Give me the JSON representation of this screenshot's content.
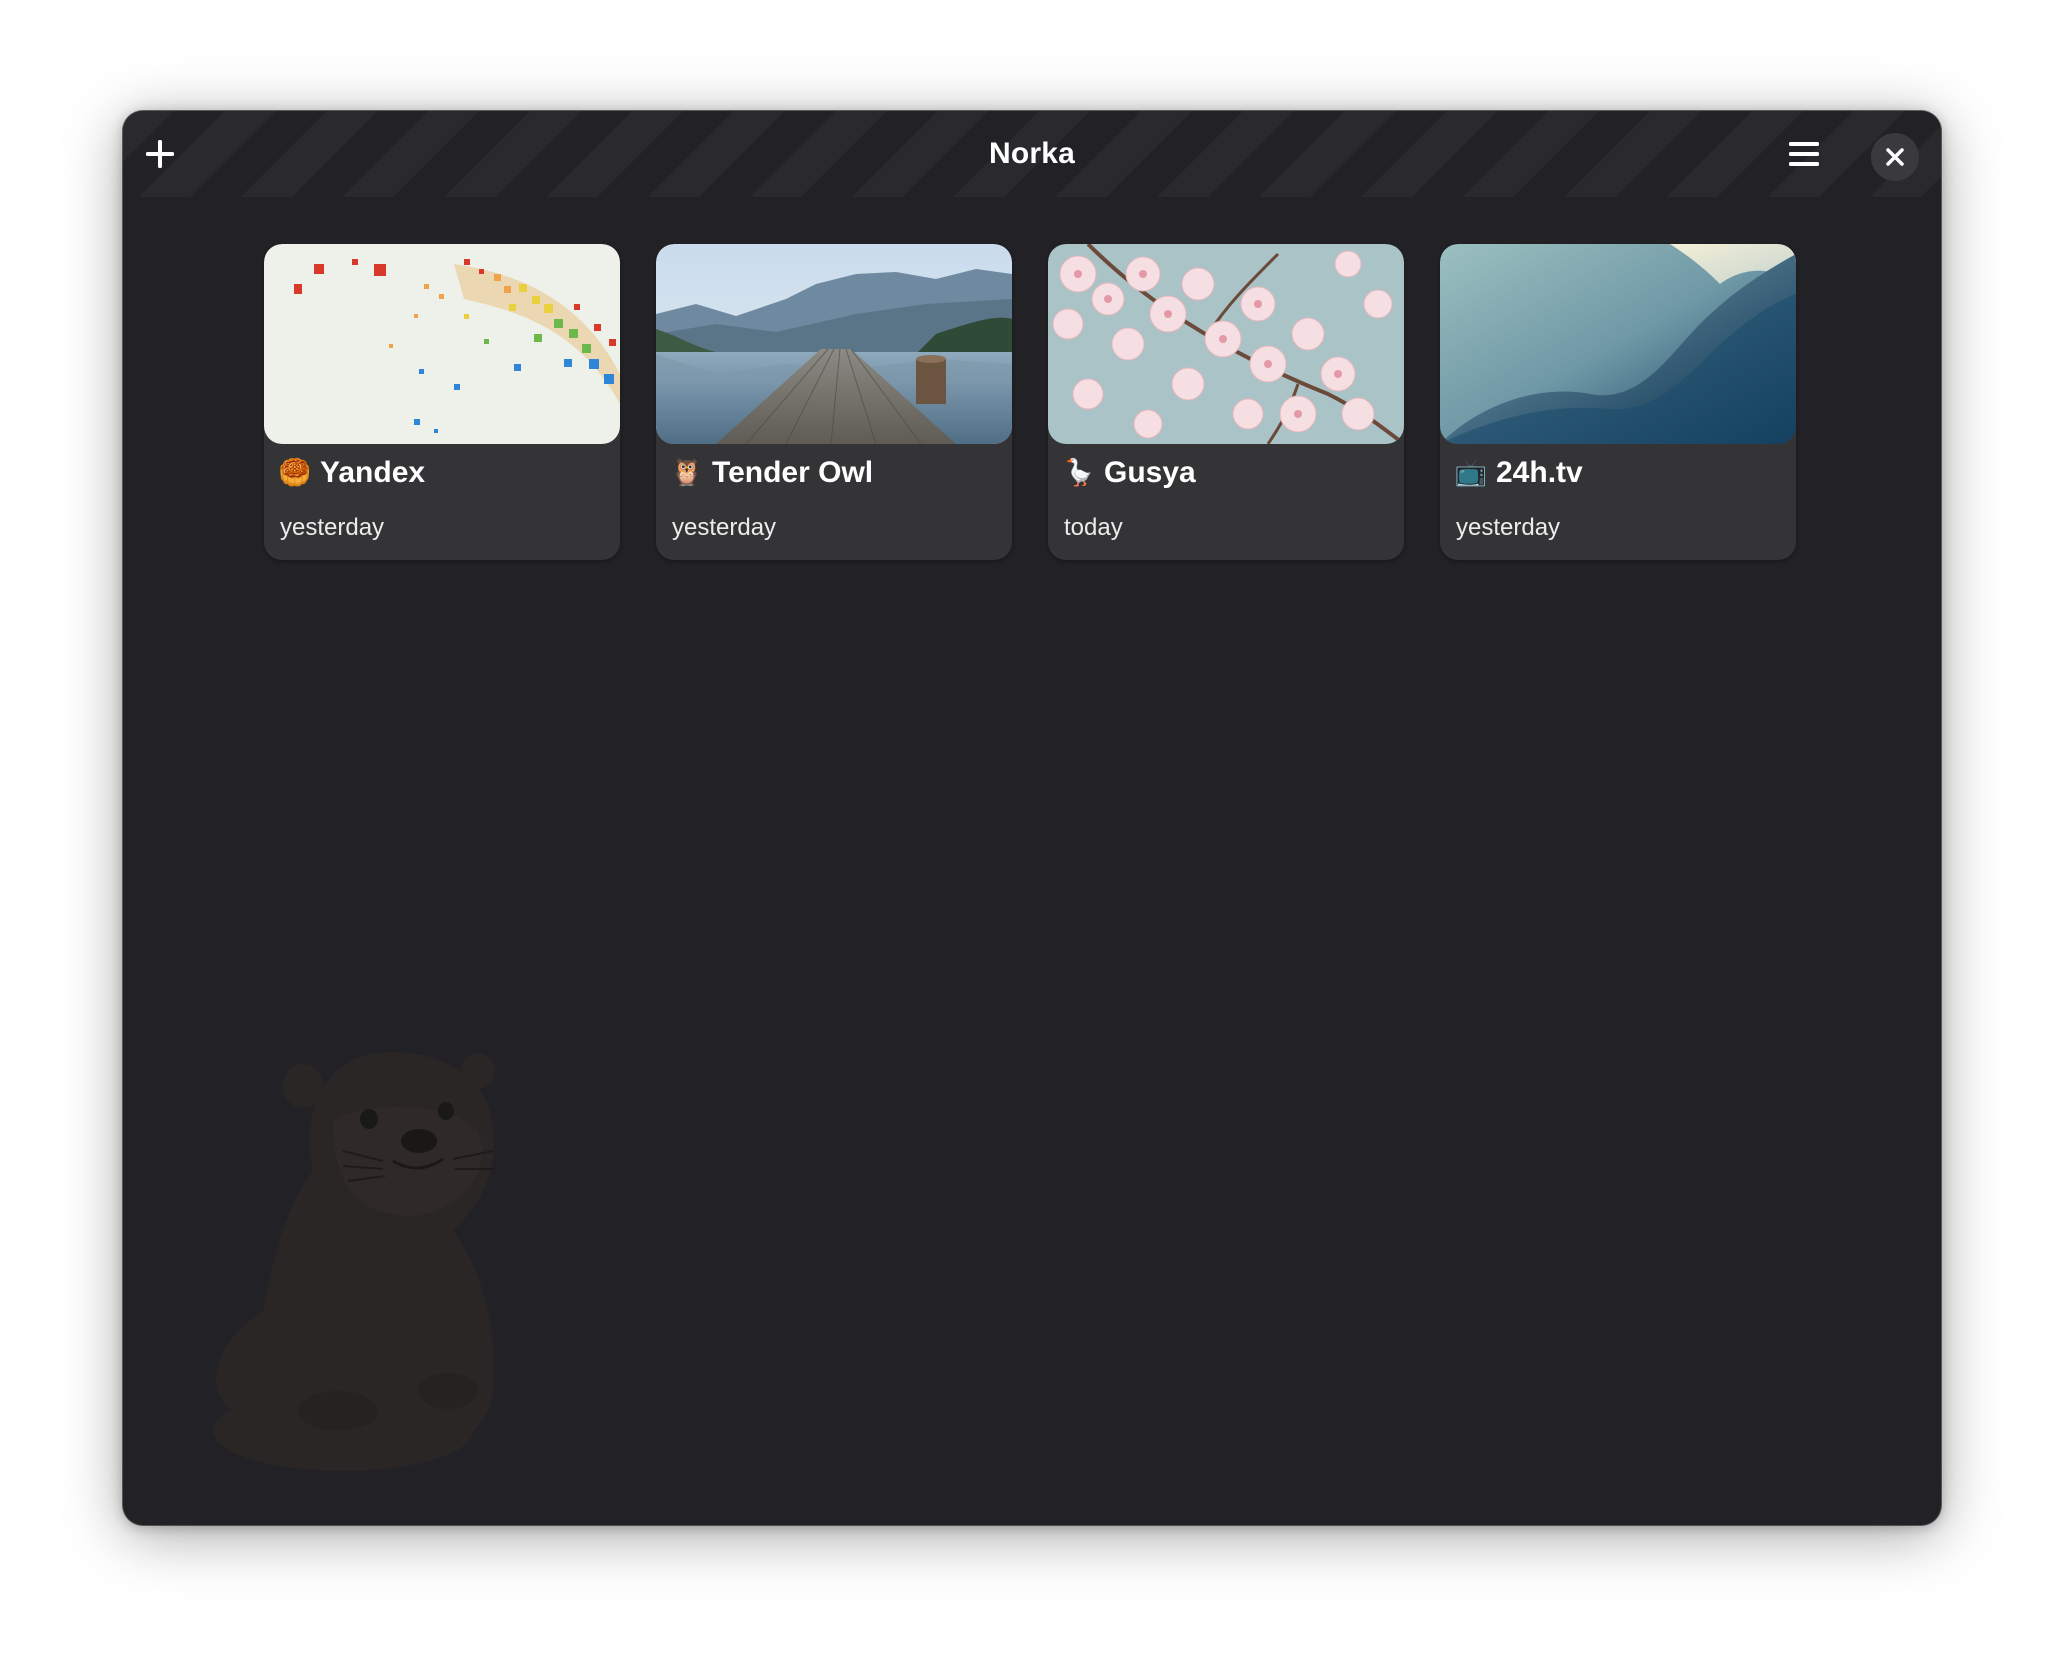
{
  "window": {
    "title": "Norka"
  },
  "header": {
    "add_icon": "plus-icon",
    "menu_icon": "hamburger-menu-icon",
    "close_icon": "close-icon"
  },
  "notes": [
    {
      "title": "Yandex",
      "emoji": "🥮",
      "emoji_icon": "mooncake-emoji-icon",
      "date": "yesterday",
      "image": "rainbow-confetti-image"
    },
    {
      "title": "Tender Owl",
      "emoji": "🦉",
      "emoji_icon": "owl-emoji-icon",
      "date": "yesterday",
      "image": "lake-pier-mountains-image"
    },
    {
      "title": "Gusya",
      "emoji": "🪿",
      "emoji_icon": "goose-emoji-icon",
      "date": "today",
      "image": "cherry-blossom-image"
    },
    {
      "title": "24h.tv",
      "emoji": "📺",
      "emoji_icon": "television-emoji-icon",
      "date": "yesterday",
      "image": "abstract-blue-waves-image"
    }
  ],
  "background_mascot": "otter-illustration",
  "colors": {
    "window_bg": "#222226",
    "card_bg": "#343437",
    "text": "#ffffff"
  }
}
